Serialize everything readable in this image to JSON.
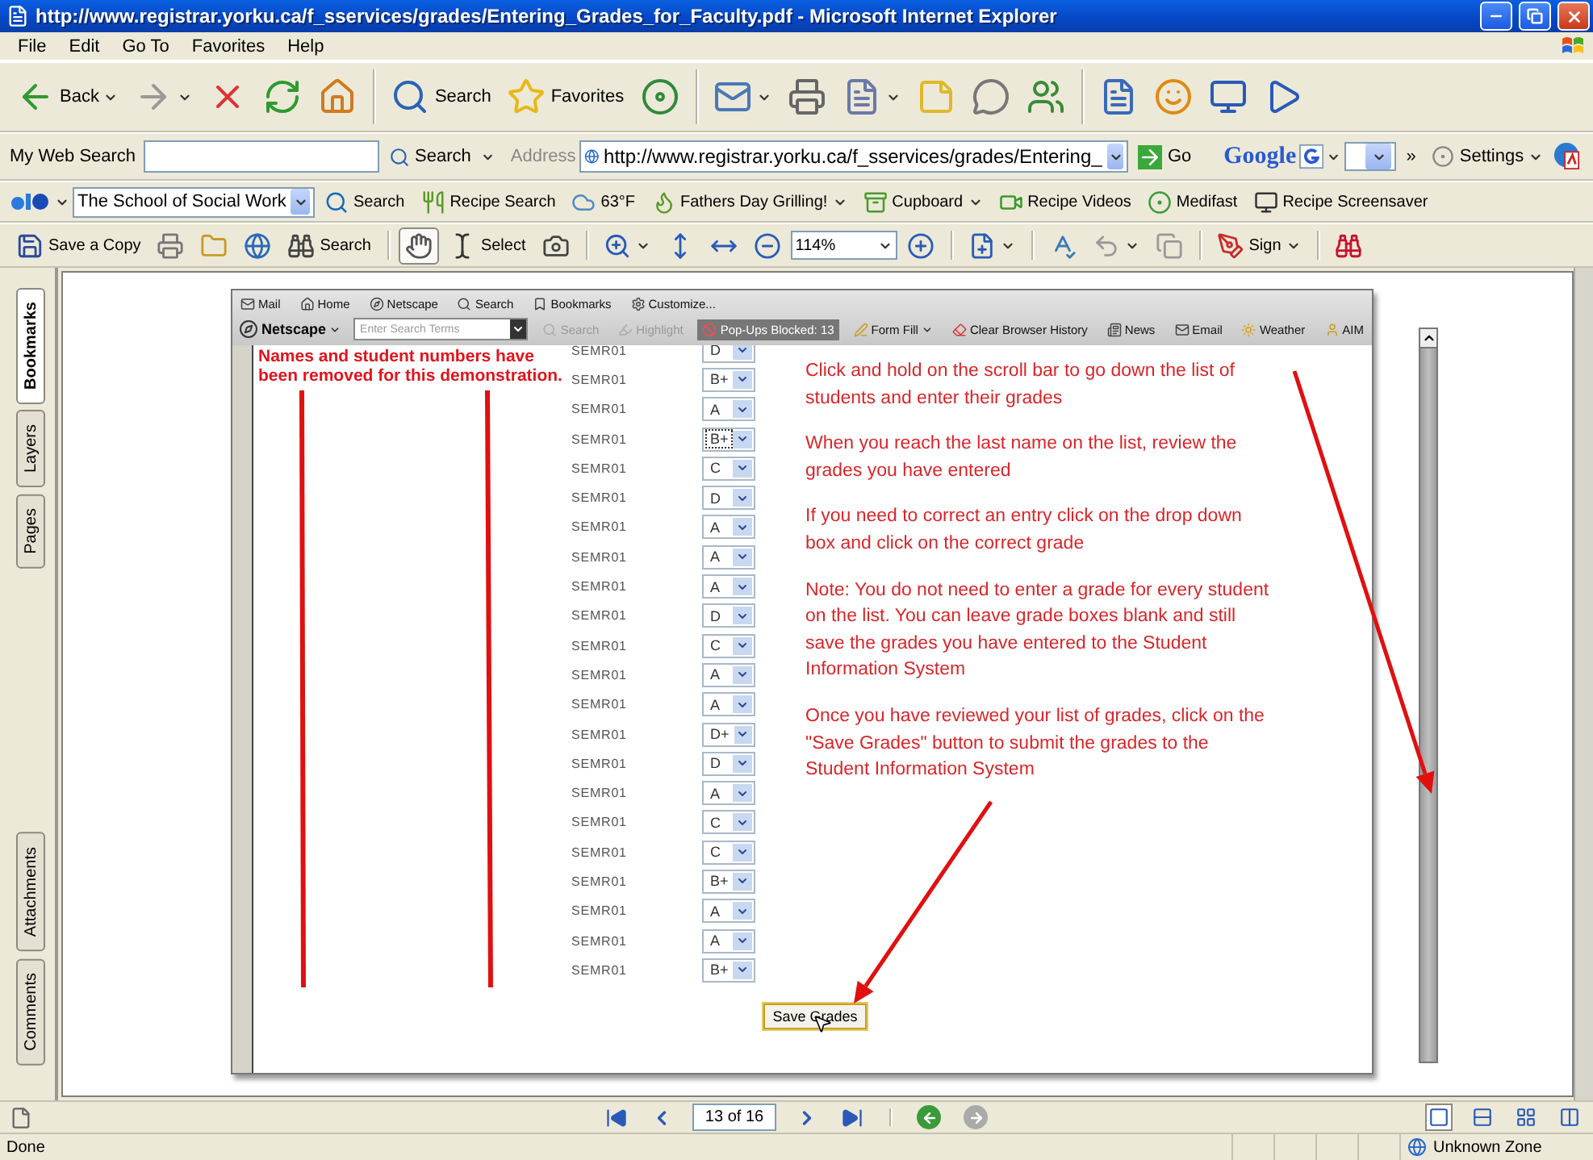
{
  "window": {
    "title": "http://www.registrar.yorku.ca/f_sservices/grades/Entering_Grades_for_Faculty.pdf - Microsoft Internet Explorer"
  },
  "menu": [
    "File",
    "Edit",
    "Go To",
    "Favorites",
    "Help"
  ],
  "standard_toolbar": [
    [
      {
        "kind": "back",
        "label": "Back",
        "dropdown": true
      },
      {
        "kind": "forward",
        "dropdown": true
      },
      {
        "kind": "stop"
      },
      {
        "kind": "refresh"
      },
      {
        "kind": "home"
      }
    ],
    [
      {
        "kind": "search",
        "label": "Search"
      },
      {
        "kind": "favorites",
        "label": "Favorites"
      },
      {
        "kind": "media"
      }
    ],
    [
      {
        "kind": "mail",
        "dropdown": true
      },
      {
        "kind": "print"
      },
      {
        "kind": "word",
        "dropdown": true
      },
      {
        "kind": "note"
      },
      {
        "kind": "discuss"
      },
      {
        "kind": "messenger"
      }
    ],
    [
      {
        "kind": "research"
      },
      {
        "kind": "smiley"
      },
      {
        "kind": "monitor"
      },
      {
        "kind": "play"
      }
    ]
  ],
  "search_bar": {
    "label": "My Web Search",
    "button": "Search",
    "address_label": "Address",
    "address": "http://www.registrar.yorku.ca/f_sservices/grades/Entering_",
    "go": "Go",
    "google": "Google",
    "more": "»",
    "settings": "Settings"
  },
  "links_bar": {
    "combo": "The School of Social Work",
    "items": [
      {
        "kind": "search",
        "label": "Search"
      },
      {
        "kind": "recipe",
        "label": "Recipe Search"
      },
      {
        "kind": "weather",
        "label": "63°F"
      },
      {
        "kind": "grill",
        "label": "Fathers Day Grilling!",
        "dropdown": true
      },
      {
        "kind": "cupboard",
        "label": "Cupboard",
        "dropdown": true
      },
      {
        "kind": "video",
        "label": "Recipe Videos"
      },
      {
        "kind": "medifast",
        "label": "Medifast"
      },
      {
        "kind": "screensaver",
        "label": "Recipe Screensaver"
      }
    ]
  },
  "acrobat_toolbar": [
    [
      {
        "kind": "save",
        "label": "Save a Copy"
      },
      {
        "kind": "print"
      },
      {
        "kind": "organizer"
      },
      {
        "kind": "email"
      },
      {
        "kind": "binoculars",
        "label": "Search"
      }
    ],
    [
      {
        "kind": "hand",
        "selected": true
      },
      {
        "kind": "select",
        "label": "Select",
        "selected": false
      },
      {
        "kind": "snapshot",
        "selected": false
      }
    ],
    [
      {
        "kind": "zoomin",
        "dropdown": true
      },
      {
        "kind": "fitpage"
      },
      {
        "kind": "fitwidth"
      },
      {
        "kind": "zoomout"
      },
      {
        "kind": "zoom",
        "label": "114%"
      },
      {
        "kind": "zoomplus"
      }
    ],
    [
      {
        "kind": "page",
        "dropdown": true
      }
    ],
    [
      {
        "kind": "spell"
      },
      {
        "kind": "undo",
        "dropdown": true
      },
      {
        "kind": "copy"
      }
    ],
    [
      {
        "kind": "sign",
        "label": "Sign",
        "dropdown": true
      }
    ],
    [
      {
        "kind": "yahoo"
      }
    ]
  ],
  "sidebar": {
    "top": [
      {
        "label": "Bookmarks",
        "selected": true
      },
      {
        "label": "Layers",
        "selected": false
      },
      {
        "label": "Pages",
        "selected": false
      }
    ],
    "bottom": [
      {
        "label": "Attachments",
        "selected": false
      },
      {
        "label": "Comments",
        "selected": false
      }
    ]
  },
  "document": {
    "netscape_toolbar": {
      "links": [
        {
          "kind": "mail",
          "label": "Mail"
        },
        {
          "kind": "home",
          "label": "Home"
        },
        {
          "kind": "netscape",
          "label": "Netscape"
        },
        {
          "kind": "search",
          "label": "Search"
        },
        {
          "kind": "bookmarks",
          "label": "Bookmarks"
        },
        {
          "kind": "customize",
          "label": "Customize..."
        }
      ],
      "brand": "Netscape",
      "search_placeholder": "Enter Search Terms",
      "tools": [
        {
          "kind": "search",
          "label": "Search",
          "disabled": true
        },
        {
          "kind": "highlight",
          "label": "Highlight",
          "disabled": true
        },
        {
          "kind": "popups",
          "label": "Pop-Ups Blocked: 13",
          "disabled": false
        },
        {
          "kind": "formfill",
          "label": "Form Fill",
          "dropdown": true,
          "disabled": false
        },
        {
          "kind": "clear",
          "label": "Clear Browser History",
          "disabled": false
        },
        {
          "kind": "news",
          "label": "News",
          "disabled": false
        },
        {
          "kind": "email",
          "label": "Email",
          "disabled": false
        },
        {
          "kind": "weather",
          "label": "Weather",
          "disabled": false
        },
        {
          "kind": "aim",
          "label": "AIM",
          "disabled": false
        }
      ]
    },
    "note": [
      "Names and student numbers have",
      "been removed for this demonstration."
    ],
    "grades": [
      {
        "course": "SEMR01",
        "grade": "D",
        "focused": false
      },
      {
        "course": "SEMR01",
        "grade": "B+",
        "focused": false
      },
      {
        "course": "SEMR01",
        "grade": "A",
        "focused": false
      },
      {
        "course": "SEMR01",
        "grade": "B+",
        "focused": true
      },
      {
        "course": "SEMR01",
        "grade": "C",
        "focused": false
      },
      {
        "course": "SEMR01",
        "grade": "D",
        "focused": false
      },
      {
        "course": "SEMR01",
        "grade": "A",
        "focused": false
      },
      {
        "course": "SEMR01",
        "grade": "A",
        "focused": false
      },
      {
        "course": "SEMR01",
        "grade": "A",
        "focused": false
      },
      {
        "course": "SEMR01",
        "grade": "D",
        "focused": false
      },
      {
        "course": "SEMR01",
        "grade": "C",
        "focused": false
      },
      {
        "course": "SEMR01",
        "grade": "A",
        "focused": false
      },
      {
        "course": "SEMR01",
        "grade": "A",
        "focused": false
      },
      {
        "course": "SEMR01",
        "grade": "D+",
        "focused": false
      },
      {
        "course": "SEMR01",
        "grade": "D",
        "focused": false
      },
      {
        "course": "SEMR01",
        "grade": "A",
        "focused": false
      },
      {
        "course": "SEMR01",
        "grade": "C",
        "focused": false
      },
      {
        "course": "SEMR01",
        "grade": "C",
        "focused": false
      },
      {
        "course": "SEMR01",
        "grade": "B+",
        "focused": false
      },
      {
        "course": "SEMR01",
        "grade": "A",
        "focused": false
      },
      {
        "course": "SEMR01",
        "grade": "A",
        "focused": false
      },
      {
        "course": "SEMR01",
        "grade": "B+",
        "focused": false
      }
    ],
    "instructions": [
      [
        "Click and hold on the scroll bar to go down the list of",
        "students and enter their grades"
      ],
      [
        "When you reach the last name on the list, review the",
        "grades you have entered"
      ],
      [
        "If you need to correct an entry click on the drop down",
        "box and click on the correct grade"
      ],
      [
        "Note:  You do not need to enter a grade for every student",
        "on the list.  You can leave grade boxes blank and still",
        "save the grades you have entered to the Student",
        "Information System"
      ],
      [
        "Once you have reviewed your list of grades, click on the",
        "\"Save Grades\" button to submit the grades to the",
        "Student Information System"
      ]
    ],
    "save_button": "Save Grades"
  },
  "page_nav": {
    "page": "13 of 16"
  },
  "status": {
    "text": "Done",
    "zone": "Unknown Zone"
  }
}
